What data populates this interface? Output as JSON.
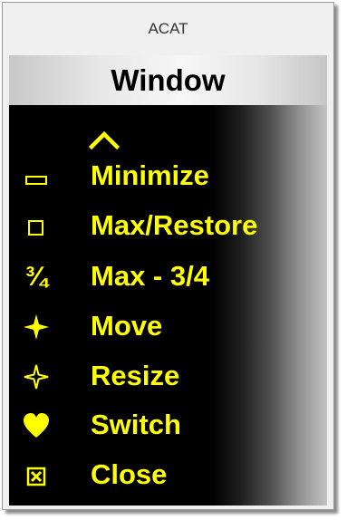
{
  "window": {
    "title": "ACAT"
  },
  "header": {
    "title": "Window"
  },
  "menu": {
    "scroll_up_icon": "chevron-up-icon",
    "accent_color": "#ffff00",
    "background_color": "#000000",
    "items": [
      {
        "label": "Minimize",
        "icon": "minimize-icon"
      },
      {
        "label": "Max/Restore",
        "icon": "maximize-icon"
      },
      {
        "label": "Max - 3/4",
        "icon": "three-quarters-icon",
        "icon_text": "¾"
      },
      {
        "label": "Move",
        "icon": "move-star-icon"
      },
      {
        "label": "Resize",
        "icon": "resize-star-icon"
      },
      {
        "label": "Switch",
        "icon": "heart-icon"
      },
      {
        "label": "Close",
        "icon": "close-box-icon"
      }
    ]
  }
}
